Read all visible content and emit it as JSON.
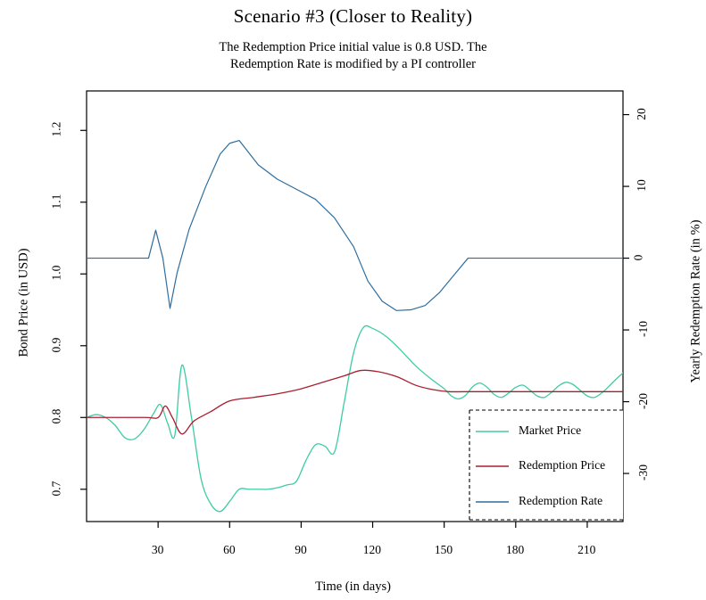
{
  "chart_data": {
    "type": "line",
    "title": "Scenario #3 (Closer to Reality)",
    "subtitle_line1": "The Redemption Price initial value is 0.8 USD. The",
    "subtitle_line2": "Redemption Rate is modified by a PI controller",
    "xlabel": "Time (in days)",
    "ylabel": "Bond Price (in USD)",
    "ylabel_right": "Yearly Redemption Rate (in %)",
    "xlim": [
      0,
      225
    ],
    "ylim": [
      0.655,
      1.255
    ],
    "ylim_right": [
      -36.7,
      23.3
    ],
    "xticks": [
      30,
      60,
      90,
      120,
      150,
      180,
      210
    ],
    "xtick_labels": [
      "30",
      "60",
      "90",
      "120",
      "150",
      "180",
      "210"
    ],
    "yticks": [
      0.7,
      0.8,
      0.9,
      1.0,
      1.1,
      1.2
    ],
    "ytick_labels": [
      "0.7",
      "0.8",
      "0.9",
      "1.0",
      "1.1",
      "1.2"
    ],
    "yticks_right": [
      -30,
      -20,
      -10,
      0,
      10,
      20
    ],
    "ytick_labels_right": [
      "-30",
      "-20",
      "-10",
      "0",
      "10",
      "20"
    ],
    "grid": false,
    "legend_position": "bottom-right",
    "colors": {
      "market_price": "#3ECCA4",
      "redemption_price": "#AA1F2E",
      "redemption_rate": "#2E6E9E",
      "frame": "#000000",
      "background": "#FFFFFF"
    },
    "series": [
      {
        "name": "Market Price",
        "axis": "left",
        "color": "#3ECCA4",
        "x": [
          0,
          4,
          8,
          12,
          16,
          20,
          24,
          28,
          31,
          34,
          37,
          40,
          44,
          48,
          52,
          56,
          60,
          64,
          68,
          72,
          76,
          80,
          84,
          88,
          92,
          96,
          100,
          104,
          108,
          112,
          116,
          120,
          126,
          132,
          138,
          144,
          150,
          153,
          156,
          159,
          162,
          165,
          168,
          171,
          174,
          177,
          180,
          183,
          186,
          189,
          192,
          195,
          198,
          201,
          204,
          207,
          210,
          213,
          216,
          219,
          222,
          225
        ],
        "y": [
          0.8,
          0.804,
          0.8,
          0.789,
          0.772,
          0.77,
          0.783,
          0.805,
          0.818,
          0.792,
          0.775,
          0.873,
          0.8,
          0.715,
          0.68,
          0.669,
          0.683,
          0.7,
          0.7,
          0.7,
          0.7,
          0.702,
          0.706,
          0.711,
          0.74,
          0.762,
          0.76,
          0.752,
          0.82,
          0.89,
          0.925,
          0.924,
          0.912,
          0.893,
          0.872,
          0.855,
          0.84,
          0.83,
          0.826,
          0.831,
          0.843,
          0.848,
          0.842,
          0.832,
          0.828,
          0.834,
          0.842,
          0.845,
          0.838,
          0.83,
          0.828,
          0.835,
          0.844,
          0.849,
          0.846,
          0.838,
          0.83,
          0.828,
          0.834,
          0.843,
          0.853,
          0.862
        ]
      },
      {
        "name": "Redemption Price",
        "axis": "left",
        "color": "#AA1F2E",
        "x": [
          0,
          24,
          30,
          33,
          36,
          40,
          45,
          52,
          60,
          70,
          80,
          90,
          100,
          108,
          115,
          122,
          130,
          138,
          145,
          152,
          160,
          180,
          200,
          225
        ],
        "y": [
          0.8,
          0.8,
          0.8,
          0.816,
          0.8,
          0.777,
          0.795,
          0.808,
          0.823,
          0.828,
          0.833,
          0.84,
          0.85,
          0.858,
          0.8655,
          0.864,
          0.857,
          0.845,
          0.839,
          0.836,
          0.836,
          0.836,
          0.836,
          0.836
        ]
      },
      {
        "name": "Redemption Rate",
        "axis": "right",
        "color": "#2E6E9E",
        "x": [
          0,
          26,
          29,
          32,
          35,
          38,
          43,
          50,
          56,
          60,
          64,
          72,
          80,
          88,
          96,
          104,
          112,
          118,
          124,
          130,
          136,
          142,
          148,
          154,
          160,
          180,
          200,
          225
        ],
        "y": [
          0.0,
          0.0,
          3.9,
          0.0,
          -7.0,
          -2.0,
          4.0,
          10.0,
          14.5,
          16.0,
          16.4,
          13.0,
          11.0,
          9.6,
          8.2,
          5.6,
          1.6,
          -3.2,
          -6.0,
          -7.3,
          -7.2,
          -6.6,
          -4.8,
          -2.4,
          0.0,
          0.0,
          0.0,
          0.0
        ]
      }
    ]
  },
  "legend": {
    "items": [
      {
        "label": "Market Price",
        "color": "#3ECCA4"
      },
      {
        "label": "Redemption Price",
        "color": "#AA1F2E"
      },
      {
        "label": "Redemption Rate",
        "color": "#2E6E9E"
      }
    ]
  }
}
